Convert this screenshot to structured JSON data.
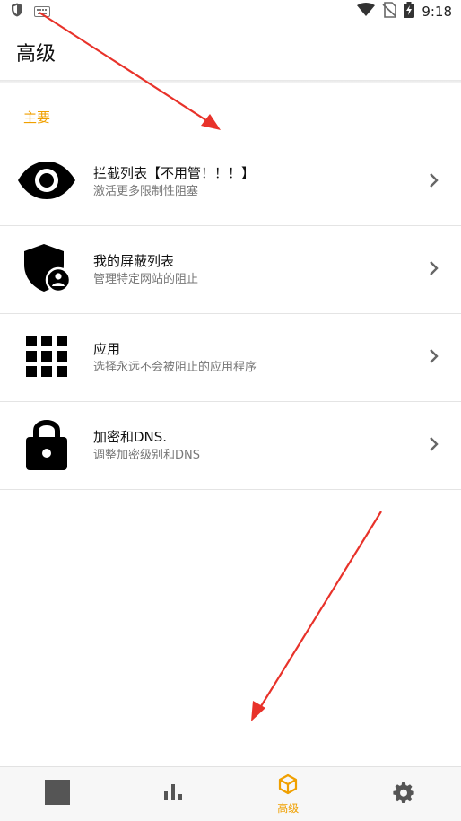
{
  "status_bar": {
    "time": "9:18",
    "icons": [
      "shield-app-icon",
      "keyboard-icon",
      "wifi-icon",
      "no-sim-icon",
      "battery-charging-icon"
    ]
  },
  "app_bar": {
    "title": "高级"
  },
  "section": {
    "header": "主要"
  },
  "items": [
    {
      "icon": "eye-icon",
      "title": "拦截列表【不用管！！！】",
      "subtitle": "激活更多限制性阻塞"
    },
    {
      "icon": "shield-user-icon",
      "title": "我的屏蔽列表",
      "subtitle": "管理特定网站的阻止"
    },
    {
      "icon": "grid-apps-icon",
      "title": "应用",
      "subtitle": "选择永远不会被阻止的应用程序"
    },
    {
      "icon": "lock-icon",
      "title": "加密和DNS.",
      "subtitle": "调整加密级别和DNS"
    }
  ],
  "bottom_nav": {
    "tabs": [
      {
        "icon": "square-home-icon",
        "label": ""
      },
      {
        "icon": "bar-chart-icon",
        "label": ""
      },
      {
        "icon": "cube-icon",
        "label": "高级",
        "active": true
      },
      {
        "icon": "gear-icon",
        "label": ""
      }
    ]
  },
  "colors": {
    "accent": "#f0a000",
    "annotation": "#e8322a"
  }
}
